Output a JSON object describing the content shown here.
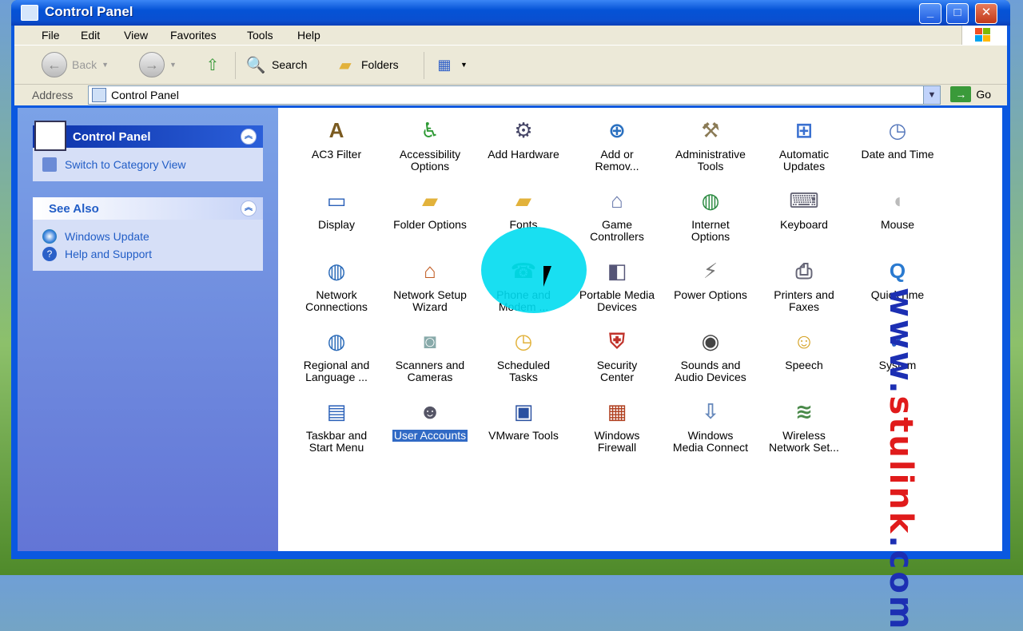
{
  "window": {
    "title": "Control Panel"
  },
  "menu": [
    "File",
    "Edit",
    "View",
    "Favorites",
    "Tools",
    "Help"
  ],
  "toolbar": {
    "back": "Back",
    "search": "Search",
    "folders": "Folders"
  },
  "address": {
    "label": "Address",
    "value": "Control Panel",
    "go": "Go"
  },
  "sidebar": {
    "control_panel": {
      "title": "Control Panel",
      "link": "Switch to Category View"
    },
    "see_also": {
      "title": "See Also",
      "links": [
        "Windows Update",
        "Help and Support"
      ]
    }
  },
  "items": [
    [
      "AC3 Filter"
    ],
    [
      "Accessibility",
      "Options"
    ],
    [
      "Add Hardware"
    ],
    [
      "Add or",
      "Remov..."
    ],
    [
      "Administrative",
      "Tools"
    ],
    [
      "Automatic",
      "Updates"
    ],
    [
      "Date and Time"
    ],
    [
      "Display"
    ],
    [
      "Folder Options"
    ],
    [
      "Fonts"
    ],
    [
      "Game",
      "Controllers"
    ],
    [
      "Internet",
      "Options"
    ],
    [
      "Keyboard"
    ],
    [
      "Mouse"
    ],
    [
      "Network",
      "Connections"
    ],
    [
      "Network Setup",
      "Wizard"
    ],
    [
      "Phone and",
      "Modem ..."
    ],
    [
      "Portable Media",
      "Devices"
    ],
    [
      "Power Options"
    ],
    [
      "Printers and",
      "Faxes"
    ],
    [
      "QuickTime"
    ],
    [
      "Regional and",
      "Language ..."
    ],
    [
      "Scanners and",
      "Cameras"
    ],
    [
      "Scheduled",
      "Tasks"
    ],
    [
      "Security",
      "Center"
    ],
    [
      "Sounds and",
      "Audio Devices"
    ],
    [
      "Speech"
    ],
    [
      "System"
    ],
    [
      "Taskbar and",
      "Start Menu"
    ],
    [
      "User Accounts"
    ],
    [
      "VMware Tools"
    ],
    [
      "Windows",
      "Firewall"
    ],
    [
      "Windows",
      "Media Connect"
    ],
    [
      "Wireless",
      "Network Set..."
    ]
  ],
  "watermark": {
    "blue": "www.",
    "red": "stulink",
    "blue2": ".com"
  }
}
